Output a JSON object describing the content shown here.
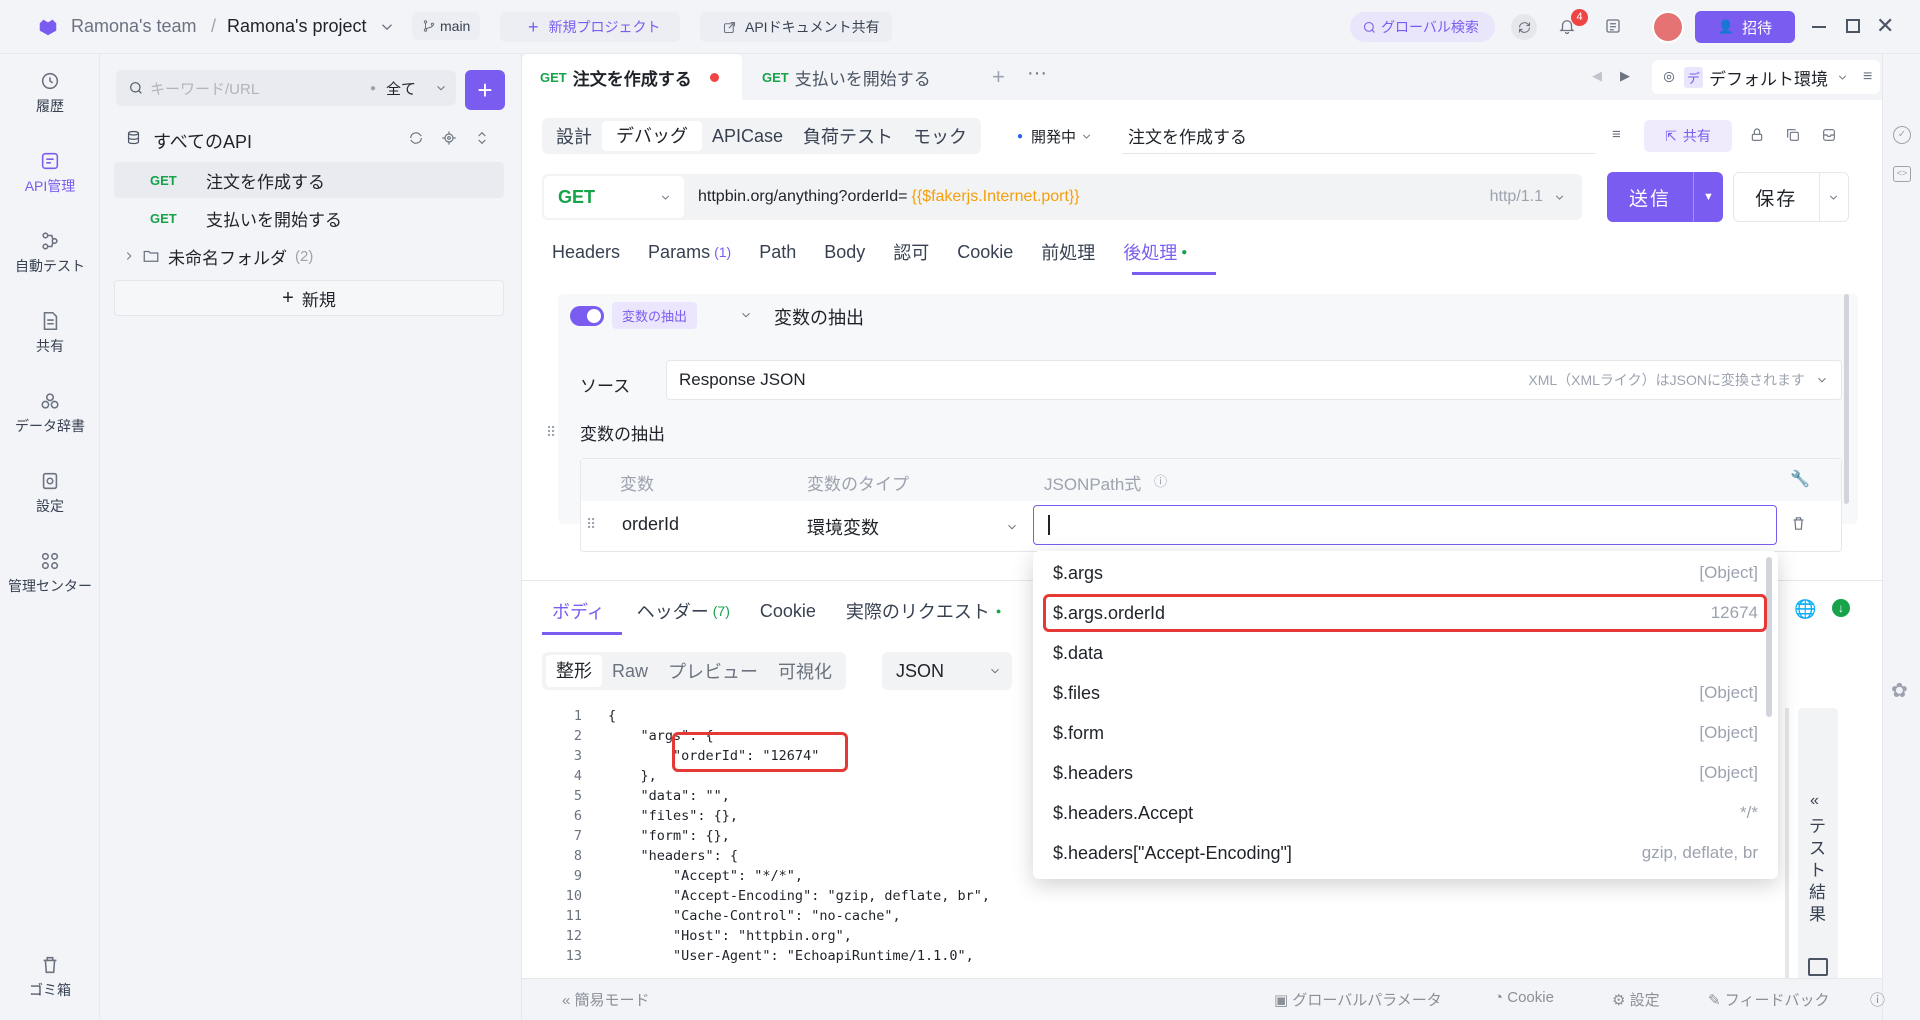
{
  "topbar": {
    "team": "Ramona's team",
    "separator": "/",
    "project": "Ramona's project",
    "branch": "main",
    "new_project": "新規プロジェクト",
    "share_docs": "APIドキュメント共有",
    "global_search": "グローバル検索",
    "notif_count": "4",
    "invite": "招待"
  },
  "sidebar": {
    "items": [
      {
        "label": "履歴",
        "icon": "history-icon"
      },
      {
        "label": "API管理",
        "icon": "api-icon"
      },
      {
        "label": "自動テスト",
        "icon": "flow-icon"
      },
      {
        "label": "共有",
        "icon": "share-doc-icon"
      },
      {
        "label": "データ辞書",
        "icon": "dictionary-icon"
      },
      {
        "label": "設定",
        "icon": "settings-icon"
      },
      {
        "label": "管理センター",
        "icon": "grid-icon"
      }
    ],
    "trash": "ゴミ箱"
  },
  "tree": {
    "search_placeholder": "キーワード/URL",
    "filter": "全て",
    "all_apis": "すべてのAPI",
    "items": [
      {
        "method": "GET",
        "name": "注文を作成する"
      },
      {
        "method": "GET",
        "name": "支払いを開始する"
      }
    ],
    "folder": "未命名フォルダ",
    "folder_count": "(2)",
    "new": "新規"
  },
  "tabs": {
    "items": [
      {
        "method": "GET",
        "name": "注文を作成する"
      },
      {
        "method": "GET",
        "name": "支払いを開始する"
      }
    ],
    "env_prefix": "デ",
    "env": "デフォルト環境"
  },
  "subtabs": {
    "items": [
      "設計",
      "デバッグ",
      "APICase",
      "負荷テスト",
      "モック"
    ],
    "status": "開発中",
    "api_name": "注文を作成する",
    "share": "共有"
  },
  "request": {
    "method": "GET",
    "url": "httpbin.org/anything?orderId=",
    "url_var": "{{$fakerjs.Internet.port}}",
    "protocol": "http/1.1",
    "send": "送信",
    "save": "保存"
  },
  "param_tabs": {
    "items": [
      "Headers",
      "Params",
      "Path",
      "Body",
      "認可",
      "Cookie",
      "前処理",
      "後処理"
    ],
    "params_count": "(1)"
  },
  "extract": {
    "tag": "変数の抽出",
    "title": "変数の抽出",
    "source_label": "ソース",
    "source_value": "Response JSON",
    "source_hint": "XML（XMLライク）はJSONに変換されます",
    "section": "変数の抽出",
    "col_var": "変数",
    "col_type": "変数のタイプ",
    "col_path": "JSONPath式",
    "row_var": "orderId",
    "row_type": "環境変数"
  },
  "dropdown": [
    {
      "path": "$.args",
      "type": "[Object]"
    },
    {
      "path": "$.args.orderId",
      "type": "12674"
    },
    {
      "path": "$.data",
      "type": ""
    },
    {
      "path": "$.files",
      "type": "[Object]"
    },
    {
      "path": "$.form",
      "type": "[Object]"
    },
    {
      "path": "$.headers",
      "type": "[Object]"
    },
    {
      "path": "$.headers.Accept",
      "type": "*/*"
    },
    {
      "path": "$.headers[\"Accept-Encoding\"]",
      "type": "gzip, deflate, br"
    }
  ],
  "response": {
    "tabs": [
      "ボディ",
      "ヘッダー",
      "Cookie",
      "実際のリクエスト"
    ],
    "header_count": "(7)",
    "formats": [
      "整形",
      "Raw",
      "プレビュー",
      "可視化"
    ],
    "lang": "JSON",
    "test_result": "テスト結果"
  },
  "code_lines": [
    "{",
    "    \"args\": {",
    "        \"orderId\": \"12674\"",
    "    },",
    "    \"data\": \"\",",
    "    \"files\": {},",
    "    \"form\": {},",
    "    \"headers\": {",
    "        \"Accept\": \"*/*\",",
    "        \"Accept-Encoding\": \"gzip, deflate, br\",",
    "        \"Cache-Control\": \"no-cache\",",
    "        \"Host\": \"httpbin.org\",",
    "        \"User-Agent\": \"EchoapiRuntime/1.1.0\","
  ],
  "statusbar": {
    "simple_mode": "簡易モード",
    "global_params": "グローバルパラメータ",
    "cookie": "Cookie",
    "settings": "設定",
    "feedback": "フィードバック"
  },
  "colors": {
    "accent": "#7b5cf0",
    "get": "#16a34a",
    "error": "#e53935"
  }
}
